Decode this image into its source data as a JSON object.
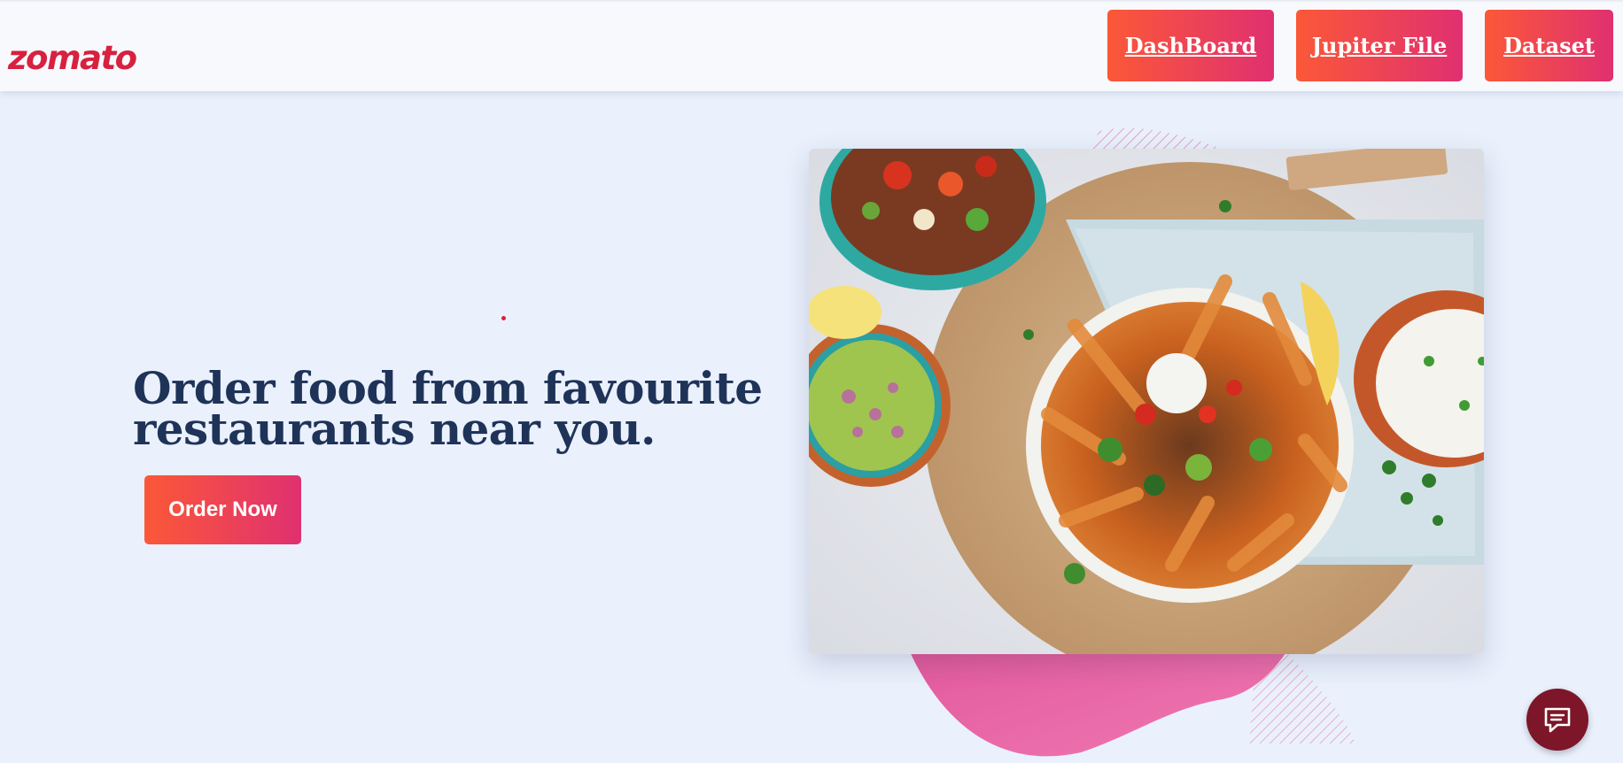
{
  "brand": {
    "logo_text": "zomato"
  },
  "nav": {
    "dashboard_label": "DashBoard",
    "jupiter_label": "Jupiter File",
    "dataset_label": "Dataset"
  },
  "hero": {
    "title": "Order food from favourite restaurants near you.",
    "cta_label": "Order Now"
  },
  "image": {
    "description_icon": "food-photo"
  },
  "chat": {
    "icon": "chat-icon"
  },
  "colors": {
    "brand_red": "#d8203f",
    "gradient_start": "#fb5838",
    "gradient_end": "#e03070",
    "title_navy": "#1f3358",
    "background": "#eaf1fd",
    "chat_bg": "#7c1628"
  }
}
